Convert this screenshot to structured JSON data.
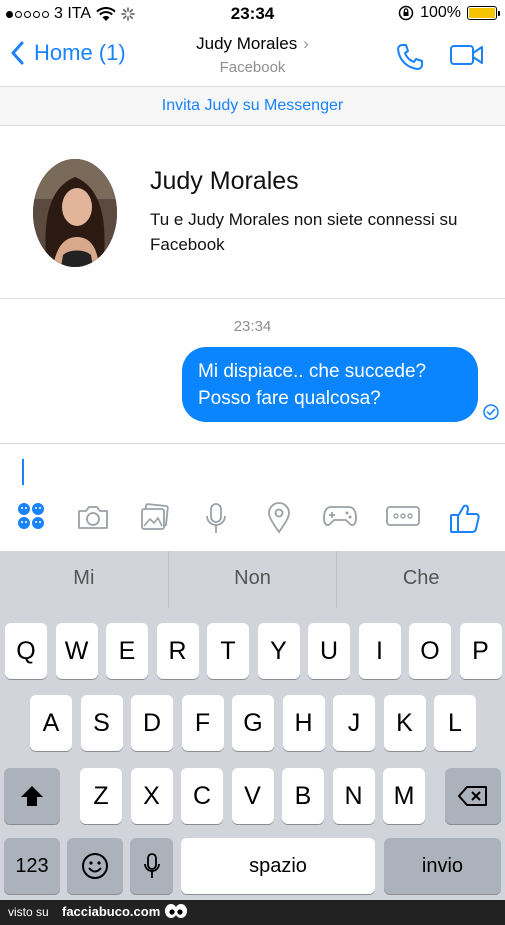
{
  "status_bar": {
    "carrier": "3 ITA",
    "time": "23:34",
    "battery": "100%",
    "signal_bars": 1,
    "battery_level": 1.0
  },
  "nav": {
    "back_label": "Home (1)",
    "contact_name": "Judy Morales",
    "contact_source": "Facebook"
  },
  "invite_banner": "Invita Judy su Messenger",
  "profile": {
    "name": "Judy Morales",
    "description": "Tu e Judy Morales non siete connessi su Facebook"
  },
  "conversation": {
    "timestamp": "23:34",
    "messages": [
      {
        "from": "me",
        "text": "Mi dispiace.. che succede? Posso fare qualcosa?"
      }
    ]
  },
  "toolbar_icons": [
    "stickers-icon",
    "camera-icon",
    "photos-icon",
    "microphone-icon",
    "location-icon",
    "games-icon",
    "more-icon",
    "like-icon"
  ],
  "keyboard": {
    "suggestions": [
      "Mi",
      "Non",
      "Che"
    ],
    "row1": [
      "Q",
      "W",
      "E",
      "R",
      "T",
      "Y",
      "U",
      "I",
      "O",
      "P"
    ],
    "row2": [
      "A",
      "S",
      "D",
      "F",
      "G",
      "H",
      "J",
      "K",
      "L"
    ],
    "row3": [
      "Z",
      "X",
      "C",
      "V",
      "B",
      "N",
      "M"
    ],
    "numbers_key": "123",
    "space_key": "spazio",
    "return_key": "invio"
  },
  "footer": {
    "visto": "visto su",
    "brand": "facciabuco.com"
  },
  "colors": {
    "accent": "#1a82fb",
    "bubble": "#0a84ff",
    "keyboard_bg": "#d1d5db"
  }
}
